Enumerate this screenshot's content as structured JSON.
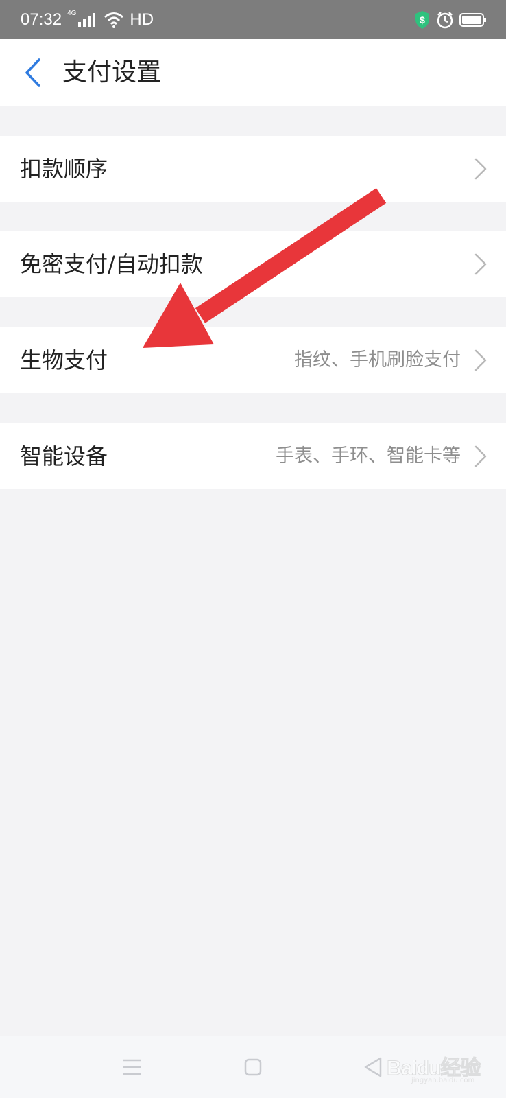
{
  "status_bar": {
    "time": "07:32",
    "network": "4G",
    "hd": "HD"
  },
  "header": {
    "title": "支付设置"
  },
  "settings": [
    {
      "label": "扣款顺序",
      "value": ""
    },
    {
      "label": "免密支付/自动扣款",
      "value": ""
    },
    {
      "label": "生物支付",
      "value": "指纹、手机刷脸支付"
    },
    {
      "label": "智能设备",
      "value": "手表、手环、智能卡等"
    }
  ],
  "watermark": {
    "brand": "Baidu经验",
    "url": "jingyan.baidu.com"
  },
  "colors": {
    "accent": "#2f7be0",
    "annotation_arrow": "#e8363a",
    "shield": "#2ec27e"
  },
  "icons": {
    "back": "chevron-left-icon",
    "row_chevron": "chevron-right-icon",
    "nav": [
      "menu-icon",
      "home-icon",
      "back-triangle-icon"
    ]
  }
}
